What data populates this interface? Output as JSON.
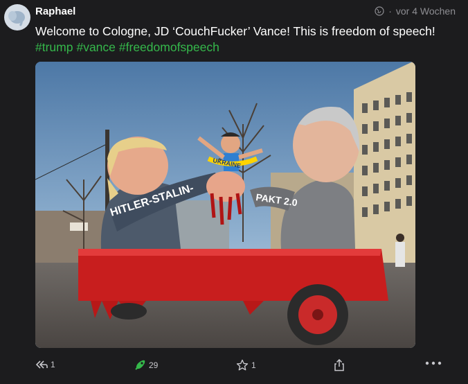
{
  "post": {
    "author": "Raphael",
    "time": "vor 4 Wochen",
    "visibility_icon": "globe-icon",
    "text": "Welcome to Cologne, JD ‘CouchFucker’ Vance! This is freedom of speech!",
    "hashtags": [
      "#trump",
      "#vance",
      "#freedomofspeech"
    ]
  },
  "image": {
    "sign_text": "HITLER-STALIN-",
    "sign_text_2": "PAKT 2.0",
    "doll_text": "UKRAINE"
  },
  "actions": {
    "reply_count": "1",
    "boost_count": "29",
    "favourite_count": "1"
  },
  "colors": {
    "background": "#1c1c1e",
    "hashtag": "#35b84b",
    "boost": "#35b84b",
    "muted": "#8e8e93"
  }
}
